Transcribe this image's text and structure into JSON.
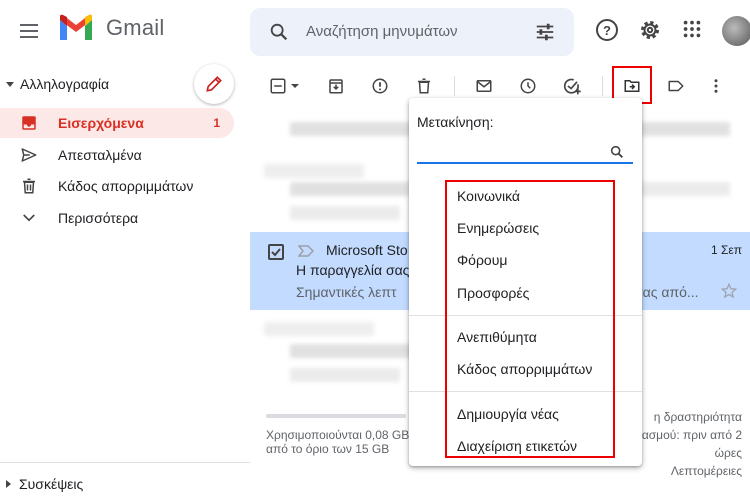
{
  "app": {
    "name": "Gmail"
  },
  "search": {
    "placeholder": "Αναζήτηση μηνυμάτων"
  },
  "sidebar": {
    "section_label": "Αλληλογραφία",
    "items": [
      {
        "label": "Εισερχόμενα",
        "count": "1",
        "icon": "inbox-icon"
      },
      {
        "label": "Απεσταλμένα",
        "icon": "send-icon"
      },
      {
        "label": "Κάδος απορριμμάτων",
        "icon": "trash-icon"
      },
      {
        "label": "Περισσότερα",
        "icon": "chevron-down-icon"
      }
    ],
    "bottom_label": "Συσκέψεις"
  },
  "mail": {
    "selected": {
      "sender": "Microsoft Sto",
      "subject": "Η παραγγελία σας",
      "snippet": "Σημαντικές λεπτ",
      "snippet_tail": "α σας από...",
      "date": "1 Σεπ"
    }
  },
  "footer": {
    "storage": "Χρησιμοποιούνται 0,08 GB από το όριο των 15 GB",
    "activity_line1": "η δραστηριότητα",
    "activity_line2": "ασμού: πριν από 2",
    "activity_line3": "ώρες",
    "details": "Λεπτομέρειες"
  },
  "move_menu": {
    "title": "Μετακίνηση:",
    "groups": [
      [
        "Κοινωνικά",
        "Ενημερώσεις",
        "Φόρουμ",
        "Προσφορές"
      ],
      [
        "Ανεπιθύμητα",
        "Κάδος απορριμμάτων"
      ],
      [
        "Δημιουργία νέας",
        "Διαχείριση ετικετών"
      ]
    ]
  },
  "colors": {
    "accent": "#1a73e8",
    "active_nav_bg": "#fce8e6",
    "active_nav_text": "#d93025",
    "selected_row": "#c2dbff",
    "highlight_box": "#ee0000"
  }
}
